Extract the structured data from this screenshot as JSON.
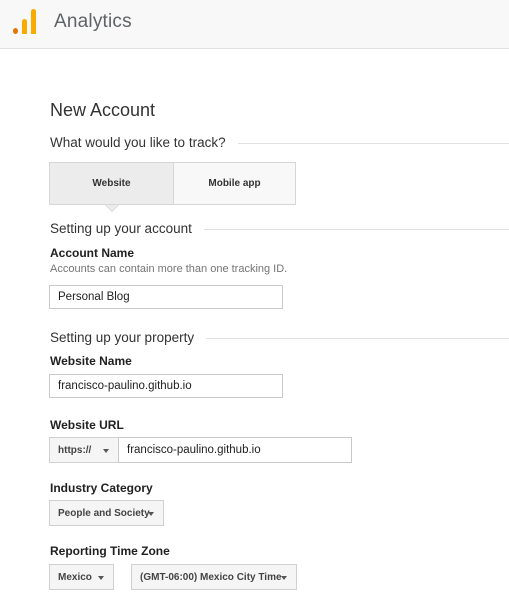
{
  "header": {
    "app_title": "Analytics"
  },
  "page": {
    "title": "New Account"
  },
  "track": {
    "question": "What would you like to track?",
    "options": [
      "Website",
      "Mobile app"
    ],
    "selected": "Website"
  },
  "account": {
    "section_title": "Setting up your account",
    "name_label": "Account Name",
    "name_hint": "Accounts can contain more than one tracking ID.",
    "name_value": "Personal Blog"
  },
  "property": {
    "section_title": "Setting up your property",
    "website_name_label": "Website Name",
    "website_name_value": "francisco-paulino.github.io",
    "website_url_label": "Website URL",
    "protocol": "https://",
    "website_url_value": "francisco-paulino.github.io",
    "industry_label": "Industry Category",
    "industry_value": "People and Society",
    "timezone_label": "Reporting Time Zone",
    "timezone_country": "Mexico",
    "timezone_value": "(GMT-06:00) Mexico City Time"
  },
  "colors": {
    "logo_dark": "#e37400",
    "logo_light": "#f9ab00"
  }
}
